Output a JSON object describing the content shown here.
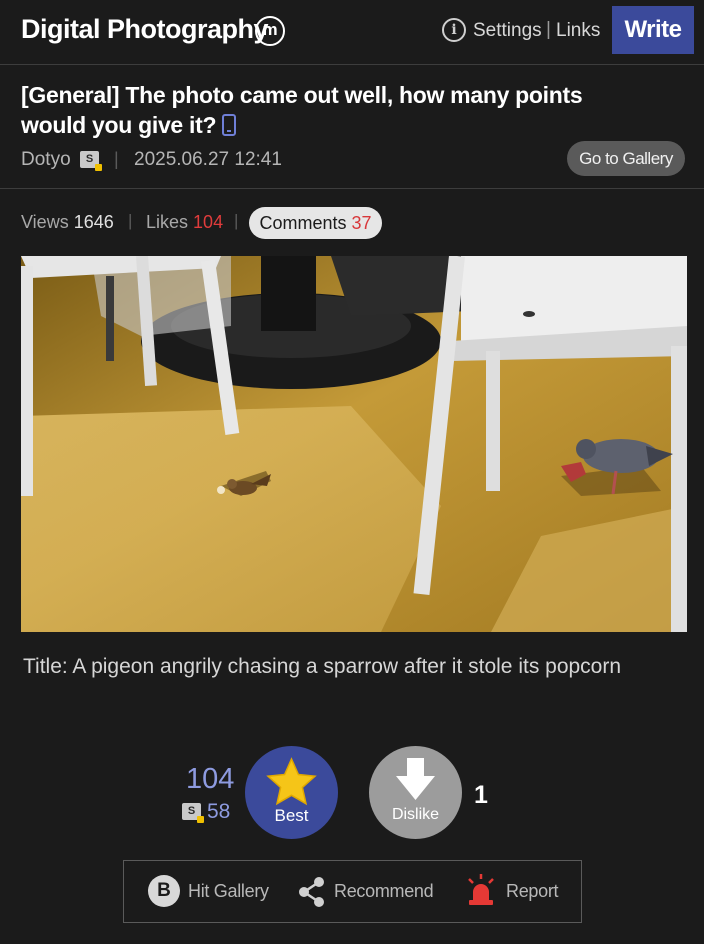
{
  "header": {
    "site_title": "Digital Photography",
    "logo_letter": "m",
    "info_glyph": "i",
    "settings": "Settings",
    "separator": "|",
    "links": "Links",
    "write": "Write"
  },
  "post": {
    "title": "[General] The photo came out well, how many points would you give it?",
    "author": "Dotyo",
    "author_badge": "S",
    "date": "2025.06.27 12:41",
    "go_to_gallery": "Go to Gallery",
    "mobile_icon": "mobile-phone-icon"
  },
  "stats": {
    "views_label": "Views",
    "views": "1646",
    "likes_label": "Likes",
    "likes": "104",
    "comments_label": "Comments",
    "comments": "37"
  },
  "caption": "Title: A pigeon angrily chasing a sparrow after it stole its popcorn",
  "vote": {
    "like_count": "104",
    "badge": "S",
    "member_count": "58",
    "best_label": "Best",
    "dislike_label": "Dislike",
    "dislike_count": "1"
  },
  "actions": {
    "hit_letter": "B",
    "hit_gallery": "Hit Gallery",
    "recommend": "Recommend",
    "report": "Report"
  },
  "colors": {
    "background": "#1b1b1b",
    "accent": "#3b4a9b",
    "highlight_red": "#e03c3c",
    "count_blue": "#8e9be0"
  }
}
